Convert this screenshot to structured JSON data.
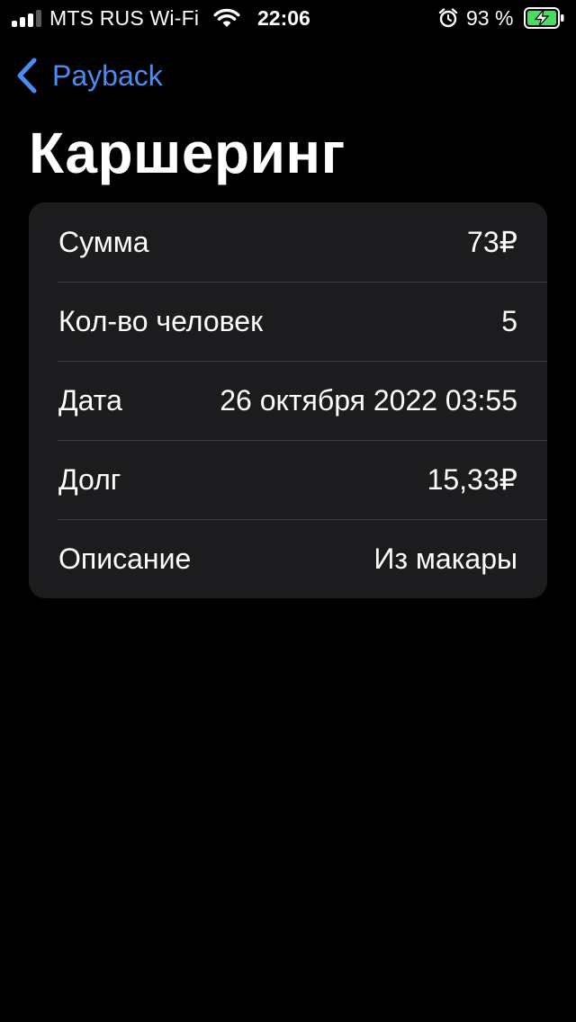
{
  "status_bar": {
    "carrier": "MTS RUS Wi-Fi",
    "time": "22:06",
    "battery_percent": "93 %",
    "signal_bars": 3,
    "signal_bars_total": 4,
    "icons": [
      "signal-icon",
      "wifi-icon",
      "alarm-icon",
      "battery-charging-icon"
    ],
    "battery_color": "#4cd964"
  },
  "nav": {
    "back_label": "Payback",
    "accent_color": "#4a8df2"
  },
  "page": {
    "title": "Каршеринг"
  },
  "details": {
    "rows": [
      {
        "label": "Сумма",
        "value": "73₽"
      },
      {
        "label": "Кол-во человек",
        "value": "5"
      },
      {
        "label": "Дата",
        "value": "26 октября 2022 03:55"
      },
      {
        "label": "Долг",
        "value": "15,33₽"
      },
      {
        "label": "Описание",
        "value": "Из макары"
      }
    ]
  }
}
